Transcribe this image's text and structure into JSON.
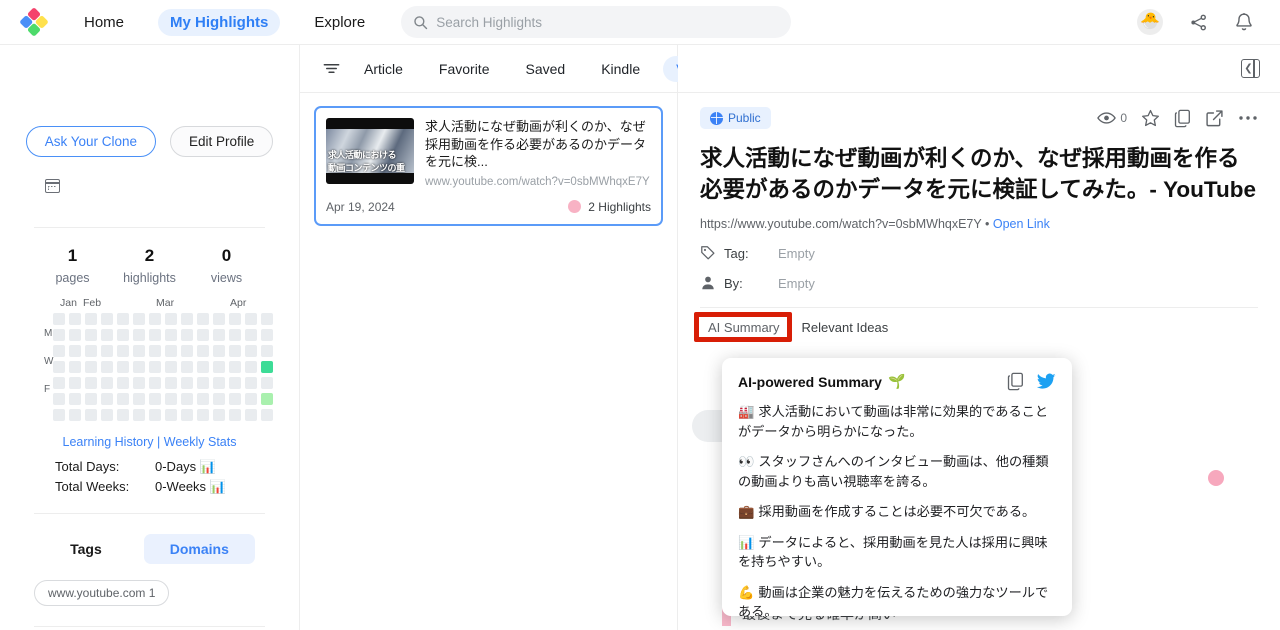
{
  "topbar": {
    "logo": "app-logo",
    "nav": [
      {
        "label": "Home",
        "active": false
      },
      {
        "label": "My Highlights",
        "active": true
      },
      {
        "label": "Explore",
        "active": false
      }
    ],
    "search_placeholder": "Search Highlights",
    "search_value": "",
    "avatar_emoji": "🐣",
    "share_icon": "share-icon",
    "bell_icon": "notification-bell-icon"
  },
  "sidebar": {
    "ask_clone_label": "Ask Your Clone",
    "edit_profile_label": "Edit Profile",
    "calendar_icon": "calendar-icon",
    "stats": [
      {
        "value": "1",
        "label": "pages"
      },
      {
        "value": "2",
        "label": "highlights"
      },
      {
        "value": "0",
        "label": "views"
      }
    ],
    "heatmap": {
      "months": [
        "Jan",
        "Feb",
        "Mar",
        "Apr"
      ],
      "day_labels": [
        "",
        "M",
        "",
        "W",
        "",
        "F",
        ""
      ],
      "columns": 14,
      "rows": 7,
      "empty_color": "#e9ecef",
      "filled": [
        {
          "row": 3,
          "col": 13,
          "color": "#3ddc97"
        },
        {
          "row": 5,
          "col": 13,
          "color": "#a9f0ae"
        }
      ]
    },
    "learning_history_label": "Learning History",
    "weekly_stats_label": "Weekly Stats",
    "links_separator": "|",
    "totals": [
      {
        "key": "Total Days:",
        "value": "0-Days",
        "emoji": "📊"
      },
      {
        "key": "Total Weeks:",
        "value": "0-Weeks",
        "emoji": "📊"
      }
    ],
    "tags_label": "Tags",
    "domains_label": "Domains",
    "domain_chip": "www.youtube.com 1"
  },
  "list": {
    "filter_icon": "filter-icon",
    "tabs": [
      {
        "label": "Article",
        "active": false
      },
      {
        "label": "Favorite",
        "active": false
      },
      {
        "label": "Saved",
        "active": false
      },
      {
        "label": "Kindle",
        "active": false
      },
      {
        "label": "Video",
        "active": true
      }
    ],
    "download_icon": "cloud-download-icon",
    "card": {
      "thumb_text_line1": "求人活動における",
      "thumb_text_line2": "動画コンテンツの重",
      "title": "求人活動になぜ動画が利くのか、なぜ採用動画を作る必要があるのかデータを元に検...",
      "url": "www.youtube.com/watch?v=0sbMWhqxE7Y",
      "date": "Apr 19, 2024",
      "highlights": "2 Highlights",
      "highlight_dot_color": "#f8b2c4"
    }
  },
  "detail": {
    "collapse_icon": "collapse-panel-icon",
    "visibility_badge": "Public",
    "globe_icon": "globe-icon",
    "view_count": "0",
    "eye_icon": "eye-icon",
    "star_icon": "star-icon",
    "copy_icon": "copy-icon",
    "share_icon": "share-export-icon",
    "more_icon": "more-options-icon",
    "title": "求人活動になぜ動画が利くのか、なぜ採用動画を作る必要があるのかデータを元に検証してみた。- YouTube",
    "url": "https://www.youtube.com/watch?v=0sbMWhqxE7Y",
    "url_separator": "•",
    "open_link_label": "Open Link",
    "tag_icon": "tag-icon",
    "tag_label": "Tag:",
    "tag_value": "Empty",
    "by_icon": "person-icon",
    "by_label": "By:",
    "by_value": "Empty",
    "subtabs": [
      {
        "label": "AI Summary",
        "selected": true
      },
      {
        "label": "Relevant Ideas",
        "selected": false
      }
    ],
    "highlight_box_color": "#d81e06",
    "behind_text": "最後まで見る確率が高い"
  },
  "popup": {
    "title": "AI-powered Summary",
    "title_emoji": "🌱",
    "copy_icon": "copy-icon",
    "twitter_icon": "twitter-icon",
    "bullets": [
      {
        "emoji": "🏭",
        "text": "求人活動において動画は非常に効果的であることがデータから明らかになった。"
      },
      {
        "emoji": "👀",
        "text": "スタッフさんへのインタビュー動画は、他の種類の動画よりも高い視聴率を誇る。"
      },
      {
        "emoji": "💼",
        "text": "採用動画を作成することは必要不可欠である。"
      },
      {
        "emoji": "📊",
        "text": "データによると、採用動画を見た人は採用に興味を持ちやすい。"
      },
      {
        "emoji": "💪",
        "text": "動画は企業の魅力を伝えるための強力なツールである。"
      }
    ]
  },
  "colors": {
    "accent_blue": "#3b82f6",
    "accent_bg": "#e8f1fe",
    "red_highlight": "#d81e06",
    "pink": "#f8b2c4"
  }
}
